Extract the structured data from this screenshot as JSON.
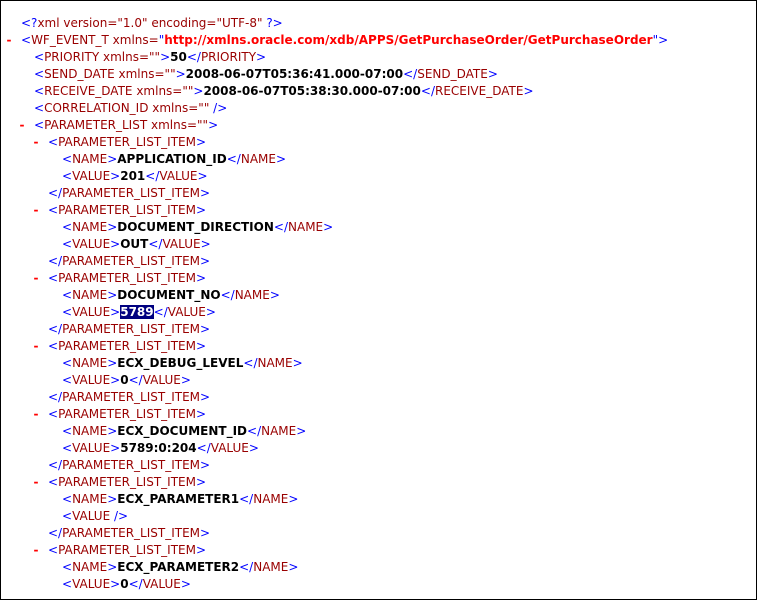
{
  "decl": {
    "open": "<?",
    "name": "xml",
    "attrs": " version=\"1.0\" encoding=\"UTF-8\" ",
    "close": "?>"
  },
  "toggle_symbol": "-",
  "root": {
    "open": "<",
    "tag": "WF_EVENT_T",
    "attr": " xmlns=",
    "q1": "\"",
    "ns": "http://xmlns.oracle.com/xdb/APPS/GetPurchaseOrder/GetPurchaseOrder",
    "q2": "\"",
    "close": ">"
  },
  "priority": {
    "lt": "<",
    "tag": "PRIORITY",
    "attr": " xmlns=\"\"",
    "gt": ">",
    "value": "50",
    "endlt": "</",
    "endtag": "PRIORITY",
    "endgt": ">"
  },
  "send_date": {
    "lt": "<",
    "tag": "SEND_DATE",
    "attr": " xmlns=\"\"",
    "gt": ">",
    "value": "2008-06-07T05:36:41.000-07:00",
    "endlt": "</",
    "endtag": "SEND_DATE",
    "endgt": ">"
  },
  "receive_date": {
    "lt": "<",
    "tag": "RECEIVE_DATE",
    "attr": " xmlns=\"\"",
    "gt": ">",
    "value": "2008-06-07T05:38:30.000-07:00",
    "endlt": "</",
    "endtag": "RECEIVE_DATE",
    "endgt": ">"
  },
  "correlation": {
    "lt": "<",
    "tag": "CORRELATION_ID",
    "attr": " xmlns=\"\"",
    "end": " />"
  },
  "param_list": {
    "lt": "<",
    "tag": "PARAMETER_LIST",
    "attr": " xmlns=\"\"",
    "gt": ">"
  },
  "items": [
    {
      "name": "APPLICATION_ID",
      "value": "201"
    },
    {
      "name": "DOCUMENT_DIRECTION",
      "value": "OUT"
    },
    {
      "name": "DOCUMENT_NO",
      "value": "5789"
    },
    {
      "name": "ECX_DEBUG_LEVEL",
      "value": "0"
    },
    {
      "name": "ECX_DOCUMENT_ID",
      "value": "5789:0:204"
    },
    {
      "name": "ECX_PARAMETER1",
      "value": ""
    },
    {
      "name": "ECX_PARAMETER2",
      "value": "0"
    }
  ],
  "item_tags": {
    "item_open": "<PARAMETER_LIST_ITEM>",
    "item_close": "</PARAMETER_LIST_ITEM>",
    "name_lt": "<",
    "name_tag": "NAME",
    "name_gt": ">",
    "name_endlt": "</",
    "name_endtag": "NAME",
    "name_endgt": ">",
    "value_lt": "<",
    "value_tag": "VALUE",
    "value_gt": ">",
    "value_endlt": "</",
    "value_endtag": "VALUE",
    "value_endgt": ">",
    "value_empty": "<VALUE />"
  },
  "selected_value": "5789"
}
